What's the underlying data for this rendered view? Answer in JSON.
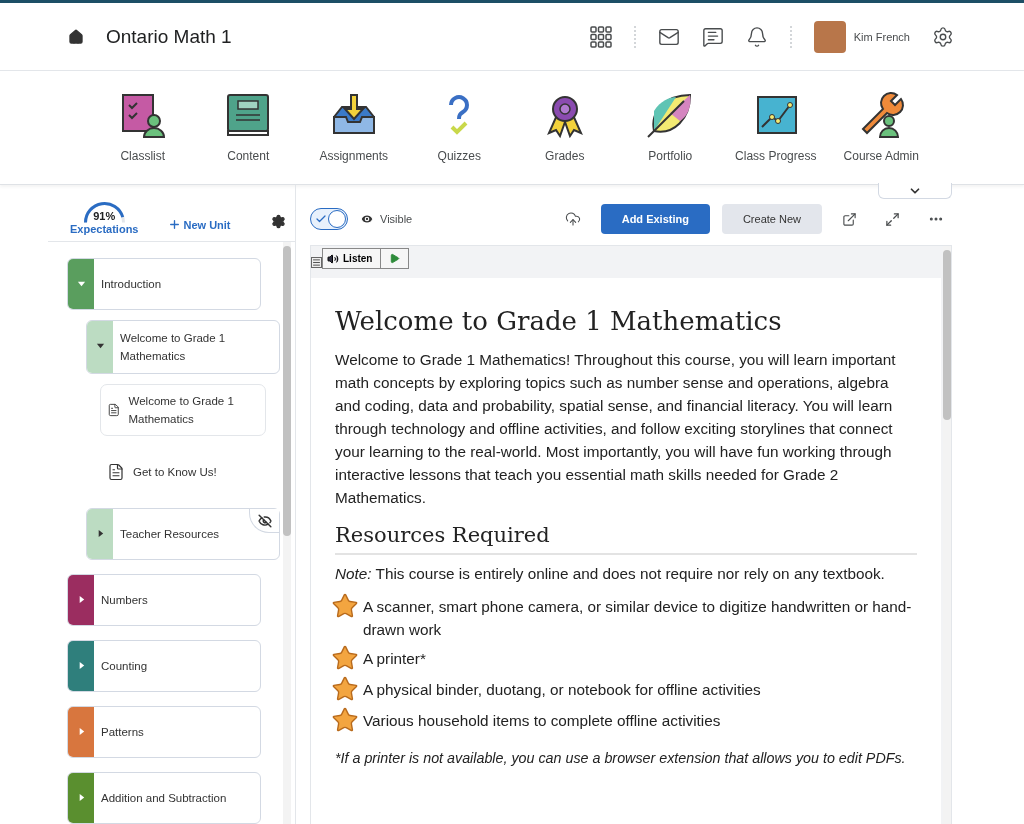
{
  "header": {
    "title": "Ontario Math 1",
    "user_name": "Kim French"
  },
  "nav": [
    {
      "label": "Classlist"
    },
    {
      "label": "Content"
    },
    {
      "label": "Assignments"
    },
    {
      "label": "Quizzes"
    },
    {
      "label": "Grades"
    },
    {
      "label": "Portfolio"
    },
    {
      "label": "Class Progress"
    },
    {
      "label": "Course Admin"
    }
  ],
  "sidebar": {
    "expectations": {
      "value": "91%",
      "label": "Expectations",
      "level": 0.91
    },
    "new_unit": "New Unit",
    "tree": [
      {
        "kind": "unit",
        "label": "Introduction",
        "color": "#5a9e5e",
        "expanded": true,
        "children": [
          {
            "kind": "module",
            "label": "Welcome to Grade 1 Mathematics",
            "color": "#bcdcc2",
            "expanded": true,
            "children": [
              {
                "kind": "topic",
                "label": "Welcome to Grade 1 Mathematics",
                "selected": true
              },
              {
                "kind": "topic",
                "label": "Get to Know Us!",
                "selected": false
              }
            ]
          },
          {
            "kind": "module",
            "label": "Teacher Resources",
            "color": "#bcdcc2",
            "expanded": false,
            "hidden": true
          }
        ]
      },
      {
        "kind": "unit",
        "label": "Numbers",
        "color": "#9b2d60",
        "expanded": false
      },
      {
        "kind": "unit",
        "label": "Counting",
        "color": "#2f7f7c",
        "expanded": false
      },
      {
        "kind": "unit",
        "label": "Patterns",
        "color": "#d8763e",
        "expanded": false
      },
      {
        "kind": "unit",
        "label": "Addition and Subtraction",
        "color": "#5a8f2f",
        "expanded": false
      }
    ]
  },
  "toolbar": {
    "visible_toggle": {
      "on": true,
      "label": "Visible"
    },
    "buttons": [
      {
        "label": "Add Existing",
        "kind": "primary"
      },
      {
        "label": "Create New",
        "kind": "secondary"
      }
    ]
  },
  "reader": {
    "label": "Listen"
  },
  "document": {
    "title": "Welcome to Grade 1 Mathematics",
    "intro": "Welcome to Grade 1 Mathematics! Throughout this course, you will learn important math concepts by exploring topics such as number sense and operations, algebra and coding, data and probability, spatial sense, and financial literacy. You will learn through technology and offline activities, and follow exciting storylines that connect your learning to the real-world. Most importantly, you will have fun working through interactive lessons that teach you essential math skills needed for Grade 2 Mathematics.",
    "section_title": "Resources Required",
    "note": "*Note:* This course is entirely online and does not require nor rely on any textbook.",
    "resources": [
      "A scanner, smart phone camera, or similar device to digitize handwritten or hand-drawn work",
      "A printer*",
      "A physical binder, duotang, or notebook for offline activities",
      "Various household items to complete offline activities"
    ],
    "footnote": "*If a printer is not available, you can use a browser extension that allows you to edit PDFs."
  }
}
